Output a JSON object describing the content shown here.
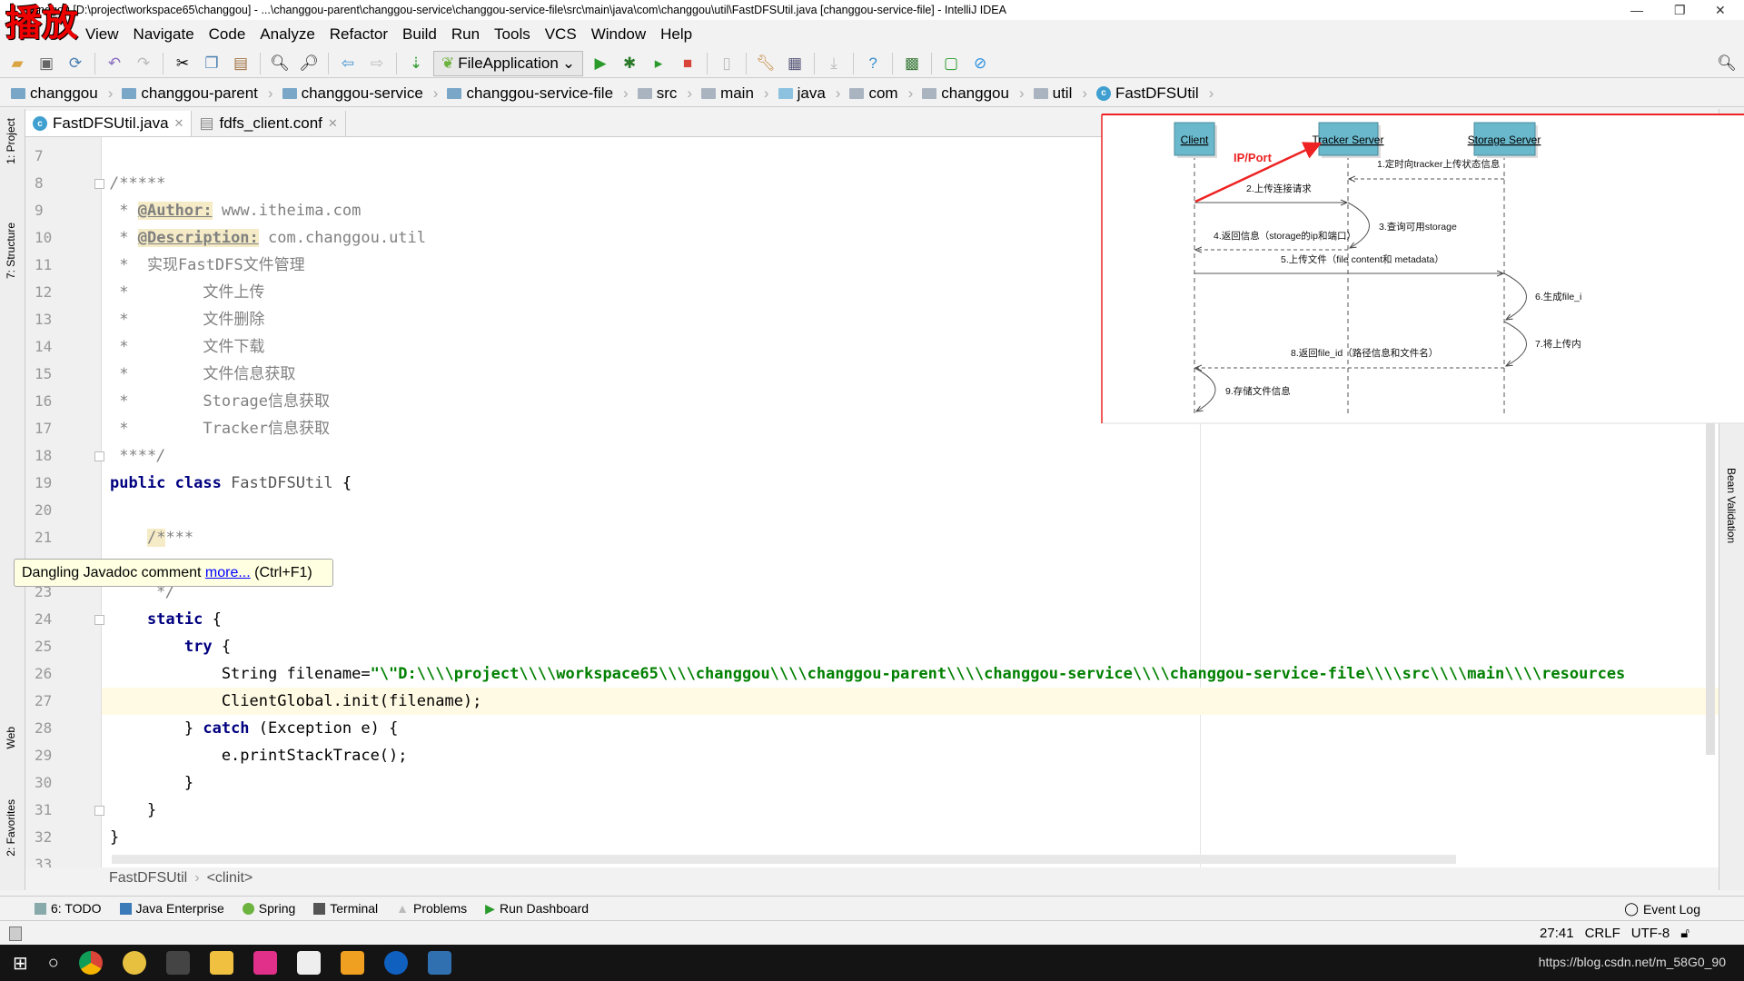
{
  "window": {
    "title": "changgou [D:\\project\\workspace65\\changgou] - ...\\changgou-parent\\changgou-service\\changgou-service-file\\src\\main\\java\\com\\changgou\\util\\FastDFSUtil.java [changgou-service-file] - IntelliJ IDEA",
    "overlay_logo": "播放"
  },
  "menu": [
    "View",
    "Navigate",
    "Code",
    "Analyze",
    "Refactor",
    "Build",
    "Run",
    "Tools",
    "VCS",
    "Window",
    "Help"
  ],
  "toolbar": {
    "run_config": "FileApplication"
  },
  "breadcrumb": [
    "changgou",
    "changgou-parent",
    "changgou-service",
    "changgou-service-file",
    "src",
    "main",
    "java",
    "com",
    "changgou",
    "util",
    "FastDFSUtil"
  ],
  "tabs": [
    {
      "label": "FastDFSUtil.java",
      "active": true
    },
    {
      "label": "fdfs_client.conf",
      "active": false
    }
  ],
  "left_strip": [
    "1: Project",
    "7: Structure",
    "Web",
    "2: Favorites"
  ],
  "right_strip": [
    "Bean Validation"
  ],
  "editor": {
    "current_line": 27,
    "lines": [
      {
        "n": 7,
        "t": []
      },
      {
        "n": 8,
        "t": [
          [
            "/*****",
            "cm"
          ]
        ]
      },
      {
        "n": 9,
        "t": [
          [
            " * ",
            "cm"
          ],
          [
            "@Author:",
            "tag"
          ],
          [
            " www.itheima.com",
            "cj"
          ]
        ]
      },
      {
        "n": 10,
        "t": [
          [
            " * ",
            "cm"
          ],
          [
            "@Description:",
            "tag"
          ],
          [
            " com.changgou.util",
            "cj"
          ]
        ]
      },
      {
        "n": 11,
        "t": [
          [
            " *  实现FastDFS文件管理",
            "cj"
          ]
        ]
      },
      {
        "n": 12,
        "t": [
          [
            " *        文件上传",
            "cj"
          ]
        ]
      },
      {
        "n": 13,
        "t": [
          [
            " *        文件删除",
            "cj"
          ]
        ]
      },
      {
        "n": 14,
        "t": [
          [
            " *        文件下载",
            "cj"
          ]
        ]
      },
      {
        "n": 15,
        "t": [
          [
            " *        文件信息获取",
            "cj"
          ]
        ]
      },
      {
        "n": 16,
        "t": [
          [
            " *        Storage信息获取",
            "cj"
          ]
        ]
      },
      {
        "n": 17,
        "t": [
          [
            " *        Tracker信息获取",
            "cj"
          ]
        ]
      },
      {
        "n": 18,
        "t": [
          [
            " ****/",
            "cm"
          ]
        ]
      },
      {
        "n": 19,
        "t": [
          [
            "public class ",
            "kw"
          ],
          [
            "FastDFSUtil",
            "cls"
          ],
          [
            " {",
            "pl"
          ]
        ]
      },
      {
        "n": 20,
        "t": []
      },
      {
        "n": 21,
        "t": [
          [
            "    ",
            "pl"
          ],
          [
            "/*",
            "dang"
          ],
          [
            "***",
            "cm"
          ]
        ]
      },
      {
        "n": 22,
        "t": []
      },
      {
        "n": 23,
        "t": [
          [
            "     */",
            "cm"
          ]
        ]
      },
      {
        "n": 24,
        "t": [
          [
            "    static ",
            "kw"
          ],
          [
            "{",
            "pl"
          ]
        ]
      },
      {
        "n": 25,
        "t": [
          [
            "        try ",
            "kw"
          ],
          [
            "{",
            "pl"
          ]
        ]
      },
      {
        "n": 26,
        "t": [
          [
            "            String filename=",
            "pl"
          ],
          [
            "\"\\\"D:\\\\\\\\project\\\\\\\\workspace65\\\\\\\\changgou\\\\\\\\changgou-parent\\\\\\\\changgou-service\\\\\\\\changgou-service-file\\\\\\\\src\\\\\\\\main\\\\\\\\resources",
            "str"
          ]
        ]
      },
      {
        "n": 27,
        "t": [
          [
            "            ClientGlobal.init(filename);",
            "pl"
          ]
        ]
      },
      {
        "n": 28,
        "t": [
          [
            "        } ",
            "pl"
          ],
          [
            "catch ",
            "kw"
          ],
          [
            "(Exception e) {",
            "pl"
          ]
        ]
      },
      {
        "n": 29,
        "t": [
          [
            "            e.printStackTrace();",
            "pl"
          ]
        ]
      },
      {
        "n": 30,
        "t": [
          [
            "        }",
            "pl"
          ]
        ]
      },
      {
        "n": 31,
        "t": [
          [
            "    }",
            "pl"
          ]
        ]
      },
      {
        "n": 32,
        "t": [
          [
            "}",
            "pl"
          ]
        ]
      },
      {
        "n": 33,
        "t": []
      }
    ]
  },
  "tooltip": {
    "text": "Dangling Javadoc comment ",
    "link": "more...",
    "shortcut": " (Ctrl+F1)"
  },
  "diagram": {
    "actors": [
      "Client",
      "Tracker Server",
      "Storage Server"
    ],
    "annotation": "IP/Port",
    "steps": [
      "1.定时向tracker上传状态信息",
      "2.上传连接请求",
      "3.查询可用storage",
      "4.返回信息（storage的ip和端口）",
      "5.上传文件（file content和 metadata）",
      "6.生成file_i",
      "7.将上传内",
      "8.返回file_id（路径信息和文件名）",
      "9.存储文件信息"
    ],
    "colors": {
      "actor_box": "#6ab8cc",
      "annotation": "#ee1111"
    }
  },
  "editor_breadcrumb": [
    "FastDFSUtil",
    "<clinit>"
  ],
  "tool_windows": [
    "6: TODO",
    "Java Enterprise",
    "Spring",
    "Terminal",
    "Problems",
    "Run Dashboard"
  ],
  "event_log": "Event Log",
  "status": {
    "position": "27:41",
    "line_sep": "CRLF",
    "encoding": "UTF-8"
  },
  "taskbar": {
    "watermark": "https://blog.csdn.net/m_58G0_90"
  }
}
